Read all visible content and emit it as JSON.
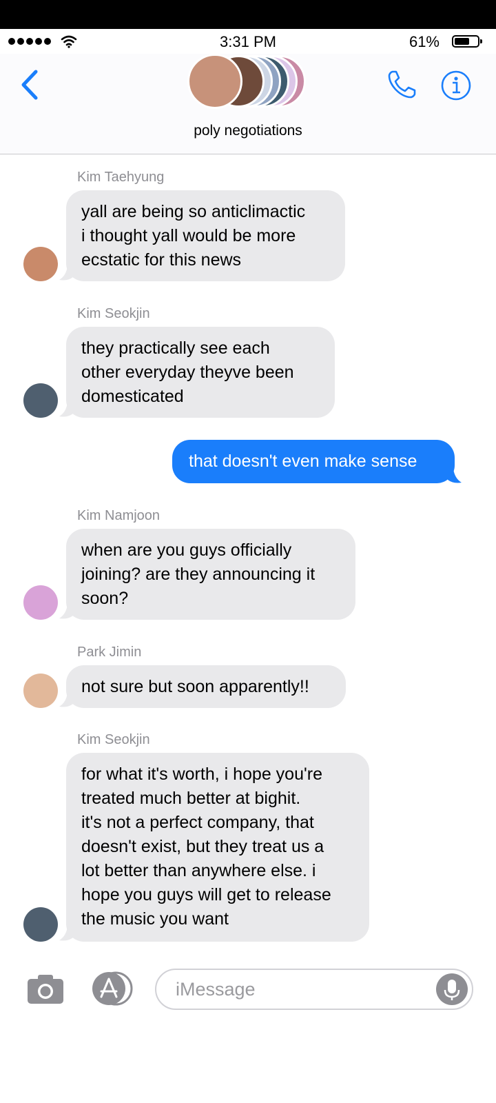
{
  "status_bar": {
    "time": "3:31 PM",
    "battery": "61%"
  },
  "header": {
    "title": "poly negotiations",
    "avatar_colors": [
      "#c98aa5",
      "#dcc6e8",
      "#3d5b6e",
      "#8fa3c2",
      "#cdd6e5",
      "#6e4a3a",
      "#c7927a"
    ]
  },
  "messages": [
    {
      "sender": "Kim Taehyung",
      "lines": [
        "yall are being so anticlimactic",
        "i thought yall would be more",
        "ecstatic for this news"
      ]
    },
    {
      "sender": "Kim Seokjin",
      "lines": [
        "they practically see each",
        "other everyday theyve been",
        "domesticated"
      ]
    },
    {
      "outgoing": "that doesn't even make sense"
    },
    {
      "sender": "Kim Namjoon",
      "lines": [
        "when are you guys officially",
        "joining? are they announcing it",
        "soon?"
      ]
    },
    {
      "sender": "Park Jimin",
      "lines": [
        "not sure but soon apparently!!"
      ]
    },
    {
      "sender": "Kim Seokjin",
      "lines": [
        "for what it's worth, i hope you're",
        "treated much better at bighit.",
        "it's not a perfect company, that",
        "doesn't exist, but they treat us a",
        "lot better than anywhere else. i",
        "hope you guys will get to release",
        "the music you want"
      ]
    }
  ],
  "input": {
    "placeholder": "iMessage"
  },
  "colors": {
    "accent": "#1a7efb",
    "incoming_bubble": "#e9e9eb"
  }
}
